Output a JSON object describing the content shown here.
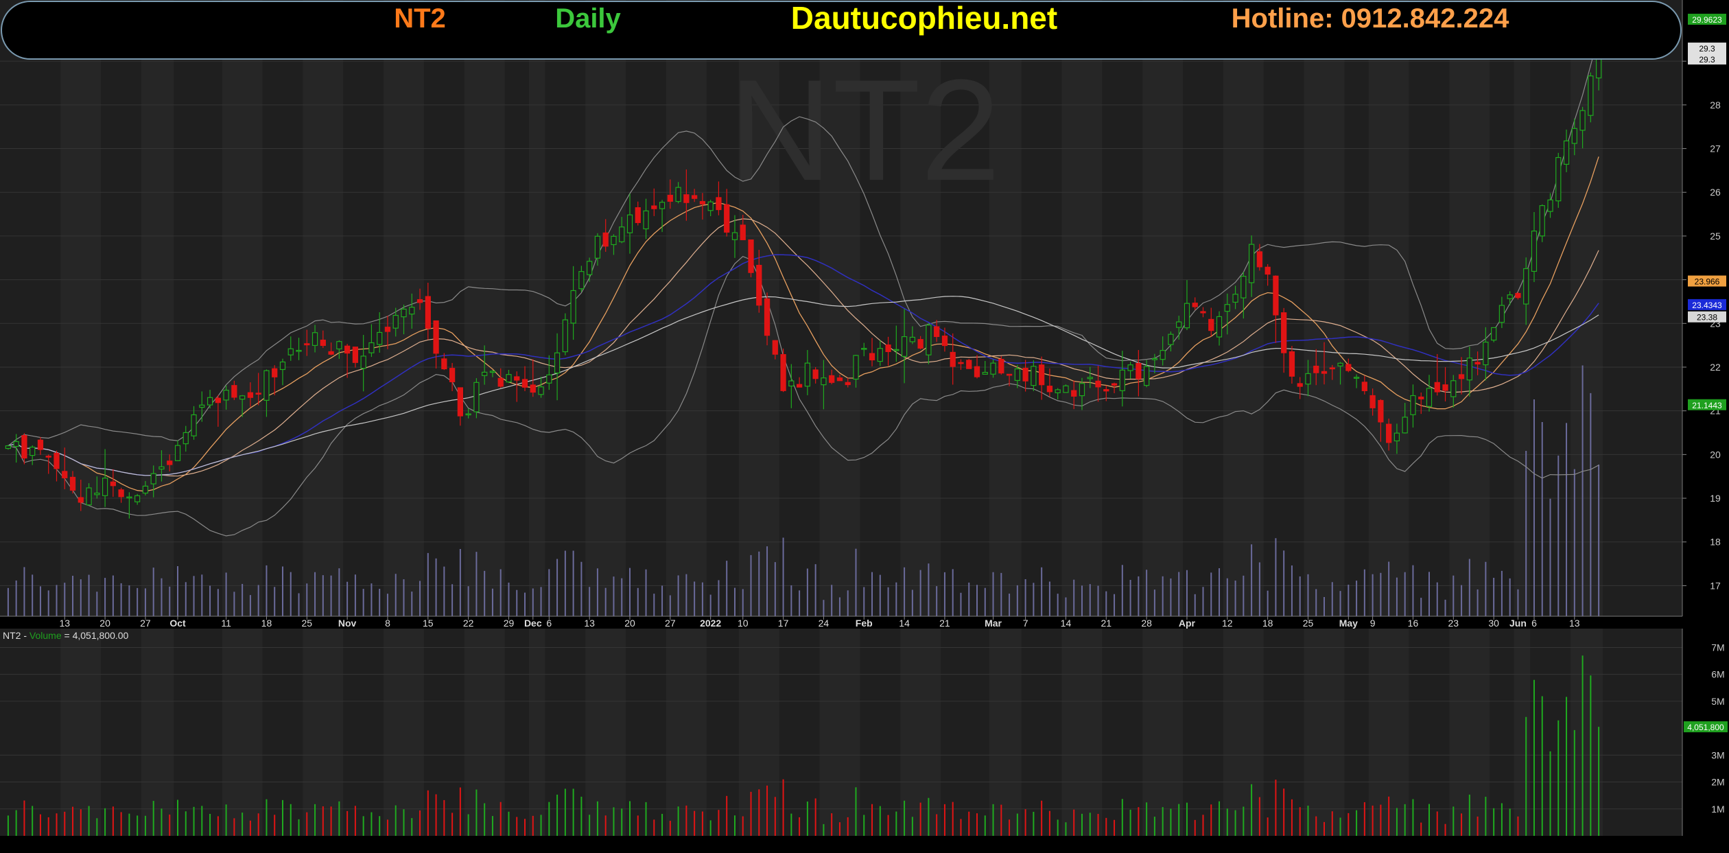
{
  "header": {
    "ticker": "NT2",
    "period": "Daily",
    "site": "Dautucophieu.net",
    "hotline": "Hotline: 0912.842.224"
  },
  "watermark": "NT2",
  "colors": {
    "background": "#1f1f1f",
    "up": "#1faa1f",
    "down": "#e01414",
    "ticker_text": "#ff7a1a",
    "period_text": "#3cc83c",
    "site_text": "#ffff00",
    "hotline_text": "#ffa04a",
    "ma_fast": "#e8a060",
    "ma_mid": "#e0b090",
    "ma_blue": "#3030c0",
    "ma_slow": "#c8c8c8",
    "bollinger": "#8a8a8a",
    "volume_overlay": "#6a6a9a"
  },
  "price_labels": [
    {
      "text": "29.9623",
      "bg": "#1fa01f",
      "fg": "#ffffff",
      "price": 29.96
    },
    {
      "text": "29.3",
      "bg": "#e0e0e0",
      "fg": "#000000",
      "price": 29.3
    },
    {
      "text": "29.3",
      "bg": "#e0e0e0",
      "fg": "#000000",
      "price": 29.05
    },
    {
      "text": "23.966",
      "bg": "#f0a040",
      "fg": "#000000",
      "price": 23.97
    },
    {
      "text": "23.4343",
      "bg": "#1a2ad8",
      "fg": "#ffffff",
      "price": 23.43
    },
    {
      "text": "23.38",
      "bg": "#d8d8d8",
      "fg": "#000000",
      "price": 23.15
    },
    {
      "text": "21.1443",
      "bg": "#1fa01f",
      "fg": "#ffffff",
      "price": 21.14
    }
  ],
  "volume_label": {
    "text": "4,051,800",
    "bg": "#1fa01f",
    "fg": "#ffffff",
    "value": 4051800
  },
  "volume_panel_title": {
    "ticker": "NT2",
    "sep": " - ",
    "name": "Volume",
    "eq": " = ",
    "value": "4,051,800.00"
  },
  "chart_data": {
    "type": "candlestick",
    "ticker": "NT2",
    "ylim": [
      16.3,
      30.4
    ],
    "yticks": [
      17,
      18,
      19,
      20,
      21,
      22,
      23,
      24,
      25,
      26,
      27,
      28,
      29
    ],
    "volume_ylim": [
      0,
      7700000
    ],
    "volume_ticks": [
      {
        "label": "7M",
        "value": 7000000
      },
      {
        "label": "6M",
        "value": 6000000
      },
      {
        "label": "5M",
        "value": 5000000
      },
      {
        "label": "3M",
        "value": 3000000
      },
      {
        "label": "2M",
        "value": 2000000
      },
      {
        "label": "1M",
        "value": 1000000
      }
    ],
    "x_ticks": [
      {
        "label": "13",
        "bar": 7,
        "bold": false
      },
      {
        "label": "20",
        "bar": 12,
        "bold": false
      },
      {
        "label": "27",
        "bar": 17,
        "bold": false
      },
      {
        "label": "Oct",
        "bar": 21,
        "bold": true
      },
      {
        "label": "11",
        "bar": 27,
        "bold": false
      },
      {
        "label": "18",
        "bar": 32,
        "bold": false
      },
      {
        "label": "25",
        "bar": 37,
        "bold": false
      },
      {
        "label": "Nov",
        "bar": 42,
        "bold": true
      },
      {
        "label": "8",
        "bar": 47,
        "bold": false
      },
      {
        "label": "15",
        "bar": 52,
        "bold": false
      },
      {
        "label": "22",
        "bar": 57,
        "bold": false
      },
      {
        "label": "29",
        "bar": 62,
        "bold": false
      },
      {
        "label": "Dec",
        "bar": 65,
        "bold": true
      },
      {
        "label": "6",
        "bar": 67,
        "bold": false
      },
      {
        "label": "13",
        "bar": 72,
        "bold": false
      },
      {
        "label": "20",
        "bar": 77,
        "bold": false
      },
      {
        "label": "27",
        "bar": 82,
        "bold": false
      },
      {
        "label": "2022",
        "bar": 87,
        "bold": true
      },
      {
        "label": "10",
        "bar": 91,
        "bold": false
      },
      {
        "label": "17",
        "bar": 96,
        "bold": false
      },
      {
        "label": "24",
        "bar": 101,
        "bold": false
      },
      {
        "label": "Feb",
        "bar": 106,
        "bold": true
      },
      {
        "label": "14",
        "bar": 111,
        "bold": false
      },
      {
        "label": "21",
        "bar": 116,
        "bold": false
      },
      {
        "label": "Mar",
        "bar": 122,
        "bold": true
      },
      {
        "label": "7",
        "bar": 126,
        "bold": false
      },
      {
        "label": "14",
        "bar": 131,
        "bold": false
      },
      {
        "label": "21",
        "bar": 136,
        "bold": false
      },
      {
        "label": "28",
        "bar": 141,
        "bold": false
      },
      {
        "label": "Apr",
        "bar": 146,
        "bold": true
      },
      {
        "label": "12",
        "bar": 151,
        "bold": false
      },
      {
        "label": "18",
        "bar": 156,
        "bold": false
      },
      {
        "label": "25",
        "bar": 161,
        "bold": false
      },
      {
        "label": "May",
        "bar": 166,
        "bold": true
      },
      {
        "label": "9",
        "bar": 169,
        "bold": false
      },
      {
        "label": "16",
        "bar": 174,
        "bold": false
      },
      {
        "label": "23",
        "bar": 179,
        "bold": false
      },
      {
        "label": "30",
        "bar": 184,
        "bold": false
      },
      {
        "label": "Jun",
        "bar": 187,
        "bold": true
      },
      {
        "label": "6",
        "bar": 189,
        "bold": false
      },
      {
        "label": "13",
        "bar": 194,
        "bold": false
      }
    ],
    "bar_count": 198,
    "anchors": [
      [
        0,
        20.2
      ],
      [
        4,
        20.1
      ],
      [
        8,
        19.0
      ],
      [
        12,
        19.3
      ],
      [
        16,
        19.1
      ],
      [
        20,
        20.0
      ],
      [
        23,
        20.9
      ],
      [
        27,
        21.4
      ],
      [
        31,
        21.6
      ],
      [
        35,
        22.3
      ],
      [
        39,
        22.7
      ],
      [
        43,
        22.0
      ],
      [
        47,
        23.0
      ],
      [
        51,
        23.4
      ],
      [
        54,
        22.0
      ],
      [
        56,
        20.9
      ],
      [
        59,
        21.7
      ],
      [
        62,
        21.8
      ],
      [
        65,
        21.2
      ],
      [
        67,
        21.6
      ],
      [
        69,
        23.2
      ],
      [
        72,
        24.6
      ],
      [
        76,
        25.4
      ],
      [
        79,
        25.5
      ],
      [
        82,
        25.9
      ],
      [
        85,
        26.0
      ],
      [
        88,
        25.5
      ],
      [
        91,
        25.0
      ],
      [
        94,
        22.8
      ],
      [
        96,
        21.3
      ],
      [
        99,
        21.9
      ],
      [
        103,
        21.5
      ],
      [
        106,
        22.3
      ],
      [
        109,
        22.4
      ],
      [
        112,
        22.6
      ],
      [
        115,
        22.8
      ],
      [
        118,
        21.9
      ],
      [
        121,
        21.8
      ],
      [
        124,
        22.0
      ],
      [
        127,
        21.8
      ],
      [
        130,
        21.5
      ],
      [
        133,
        21.5
      ],
      [
        136,
        21.6
      ],
      [
        139,
        22.0
      ],
      [
        141,
        21.8
      ],
      [
        143,
        22.4
      ],
      [
        146,
        23.3
      ],
      [
        149,
        23.0
      ],
      [
        151,
        23.2
      ],
      [
        154,
        24.7
      ],
      [
        156,
        23.9
      ],
      [
        158,
        22.5
      ],
      [
        160,
        21.5
      ],
      [
        162,
        22.0
      ],
      [
        165,
        22.2
      ],
      [
        167,
        21.8
      ],
      [
        169,
        21.3
      ],
      [
        171,
        20.2
      ],
      [
        174,
        21.4
      ],
      [
        177,
        21.6
      ],
      [
        180,
        21.9
      ],
      [
        183,
        22.4
      ],
      [
        185,
        23.4
      ],
      [
        187,
        23.6
      ],
      [
        189,
        24.9
      ],
      [
        191,
        26.0
      ],
      [
        193,
        27.2
      ],
      [
        195,
        28.0
      ],
      [
        197,
        29.3
      ]
    ],
    "wick_scale": 0.55
  }
}
